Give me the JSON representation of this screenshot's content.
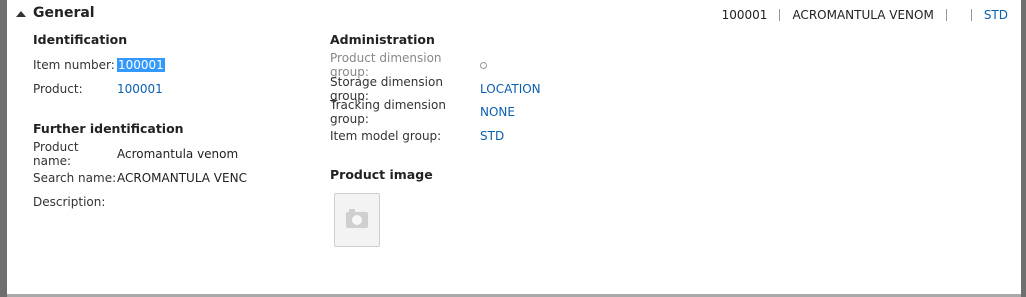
{
  "section": {
    "title": "General"
  },
  "summary": {
    "item_number": "100001",
    "name": "ACROMANTULA VENOM",
    "empty": "",
    "item_model": "STD"
  },
  "identification": {
    "title": "Identification",
    "item_number_label": "Item number:",
    "item_number_value": "100001",
    "product_label": "Product:",
    "product_value": "100001"
  },
  "further_identification": {
    "title": "Further identification",
    "product_name_label": "Product name:",
    "product_name_value": "Acromantula venom",
    "search_name_label": "Search name:",
    "search_name_value": "ACROMANTULA VENC",
    "description_label": "Description:",
    "description_value": ""
  },
  "administration": {
    "title": "Administration",
    "product_dimension_group_label": "Product dimension group:",
    "storage_dimension_group_label": "Storage dimension group:",
    "storage_dimension_group_value": "LOCATION",
    "tracking_dimension_group_label": "Tracking dimension group:",
    "tracking_dimension_group_value": "NONE",
    "item_model_group_label": "Item model group:",
    "item_model_group_value": "STD"
  },
  "product_image": {
    "title": "Product image"
  }
}
